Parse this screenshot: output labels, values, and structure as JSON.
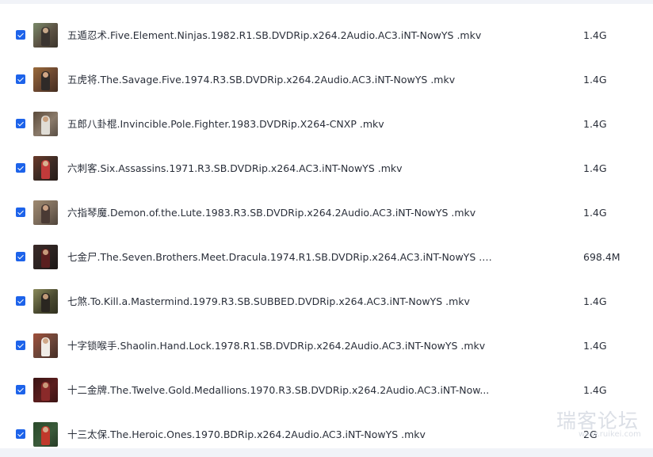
{
  "files": [
    {
      "name": "五遁忍术.Five.Element.Ninjas.1982.R1.SB.DVDRip.x264.2Audio.AC3.iNT-NowYS .mkv",
      "size": "1.4G",
      "checked": true,
      "thumb": {
        "bg": "#5a5042",
        "fig": "#3a3430",
        "head": "#c7a88a",
        "accent": "#7a8a6a"
      }
    },
    {
      "name": "五虎将.The.Savage.Five.1974.R3.SB.DVDRip.x264.2Audio.AC3.iNT-NowYS .mkv",
      "size": "1.4G",
      "checked": true,
      "thumb": {
        "bg": "#6a4630",
        "fig": "#2f2a28",
        "head": "#d0a585",
        "accent": "#9a6a3a"
      }
    },
    {
      "name": "五郎八卦棍.Invincible.Pole.Fighter.1983.DVDRip.X264-CNXP .mkv",
      "size": "1.4G",
      "checked": true,
      "thumb": {
        "bg": "#8a7a6a",
        "fig": "#e0ddd6",
        "head": "#c9a07e",
        "accent": "#5a4a3a"
      }
    },
    {
      "name": "六刺客.Six.Assassins.1971.R3.SB.DVDRip.x264.AC3.iNT-NowYS .mkv",
      "size": "1.4G",
      "checked": true,
      "thumb": {
        "bg": "#3a2a24",
        "fig": "#c23a3a",
        "head": "#d7b090",
        "accent": "#6a3a2a"
      }
    },
    {
      "name": "六指琴魔.Demon.of.the.Lute.1983.R3.SB.DVDRip.x264.2Audio.AC3.iNT-NowYS .mkv",
      "size": "1.4G",
      "checked": true,
      "thumb": {
        "bg": "#7a6a5a",
        "fig": "#4a3a34",
        "head": "#caa184",
        "accent": "#a08a70"
      }
    },
    {
      "name": "七金尸.The.Seven.Brothers.Meet.Dracula.1974.R1.SB.DVDRip.x264.AC3.iNT-NowYS .m...",
      "size": "698.4M",
      "checked": true,
      "thumb": {
        "bg": "#2a2220",
        "fig": "#5a1e1e",
        "head": "#c79a7a",
        "accent": "#3a2a28"
      }
    },
    {
      "name": "七煞.To.Kill.a.Mastermind.1979.R3.SB.SUBBED.DVDRip.x264.AC3.iNT-NowYS .mkv",
      "size": "1.4G",
      "checked": true,
      "thumb": {
        "bg": "#4a4a30",
        "fig": "#2a2620",
        "head": "#c09a78",
        "accent": "#8a8a5a"
      }
    },
    {
      "name": "十字锁喉手.Shaolin.Hand.Lock.1978.R1.SB.DVDRip.x264.2Audio.AC3.iNT-NowYS .mkv",
      "size": "1.4G",
      "checked": true,
      "thumb": {
        "bg": "#6a4438",
        "fig": "#f0ece6",
        "head": "#d0a888",
        "accent": "#a0503a"
      }
    },
    {
      "name": "十二金牌.The.Twelve.Gold.Medallions.1970.R3.SB.DVDRip.x264.2Audio.AC3.iNT-Now...",
      "size": "1.4G",
      "checked": true,
      "thumb": {
        "bg": "#5a1e1e",
        "fig": "#8a2a2a",
        "head": "#c99a7a",
        "accent": "#3a1414"
      }
    },
    {
      "name": "十三太保.The.Heroic.Ones.1970.BDRip.x264.2Audio.AC3.iNT-NowYS .mkv",
      "size": "2G",
      "checked": true,
      "thumb": {
        "bg": "#3a5a3a",
        "fig": "#c0392b",
        "head": "#d4ac8c",
        "accent": "#2a4a2a"
      }
    }
  ],
  "watermark": {
    "text": "瑞客论坛",
    "url": "www.ruikei.com"
  },
  "colors": {
    "checkbox": "#1d63ea",
    "text": "#2a2f3a",
    "background": "#f1f3f8",
    "panel": "#ffffff"
  }
}
